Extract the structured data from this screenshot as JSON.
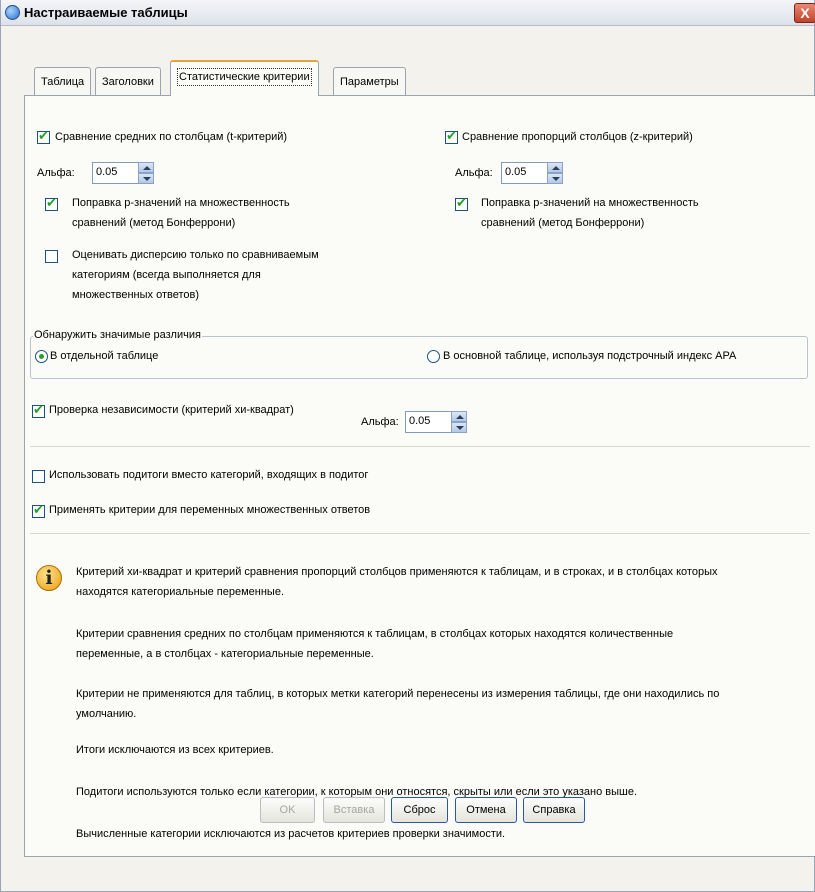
{
  "window": {
    "title": "Настраиваемые таблицы",
    "close_glyph": "X"
  },
  "tabs": [
    {
      "label": "Таблица"
    },
    {
      "label": "Заголовки"
    },
    {
      "label": "Статистические критерии",
      "active": true
    },
    {
      "label": "Параметры"
    }
  ],
  "means": {
    "label": "Сравнение средних по столбцам (t-критерий)",
    "checked": true,
    "alpha_label": "Альфа:",
    "alpha_value": "0.05",
    "bonferroni_line1": "Поправка p-значений на множественность",
    "bonferroni_line2": "сравнений (метод Бонферрони)",
    "bonferroni_checked": true,
    "variance_line1": "Оценивать дисперсию только по сравниваемым",
    "variance_line2": "категориям (всегда выполняется для",
    "variance_line3": "множественных ответов)",
    "variance_checked": false
  },
  "props": {
    "label": "Сравнение пропорций столбцов (z-критерий)",
    "checked": true,
    "alpha_label": "Альфа:",
    "alpha_value": "0.05",
    "bonferroni_line1": "Поправка p-значений на множественность",
    "bonferroni_line2": "сравнений (метод Бонферрони)",
    "bonferroni_checked": true
  },
  "identify": {
    "legend": "Обнаружить значимые различия",
    "separate_table": "В отдельной таблице",
    "main_table": "В основной таблице, используя подстрочный индекс APA",
    "selected": "separate_table"
  },
  "chisq": {
    "label": "Проверка независимости (критерий хи-квадрат)",
    "checked": true,
    "alpha_label": "Альфа:",
    "alpha_value": "0.05"
  },
  "subtotals": {
    "label": "Использовать подитоги вместо категорий, входящих в подитог",
    "checked": false
  },
  "multiresp": {
    "label": "Применять критерии для переменных множественных ответов",
    "checked": true
  },
  "notes": {
    "p1_line1": "Критерий хи-квадрат и критерий сравнения пропорций столбцов применяются к таблицам, и в строках, и в столбцах которых",
    "p1_line2": "находятся категориальные переменные.",
    "p2_line1": "Критерии сравнения средних по столбцам применяются к таблицам, в столбцах которых находятся количественные",
    "p2_line2": "переменные, а в столбцах - категориальные переменные.",
    "p3_line1": "Критерии не применяются для таблиц, в которых метки категорий перенесены из измерения таблицы, где они находились по",
    "p3_line2": "умолчанию.",
    "p4": "Итоги исключаются из всех критериев.",
    "p5": "Подитоги используются только если категории, к которым они относятся, скрыты или если это указано выше.",
    "p6": "Вычисленные категории исключаются из расчетов критериев проверки значимости."
  },
  "buttons": {
    "ok": "OK",
    "paste": "Вставка",
    "reset": "Сброс",
    "cancel": "Отмена",
    "help": "Справка"
  },
  "icons": {
    "info": "info-icon",
    "app": "app-icon"
  },
  "colors": {
    "check": "#21a121",
    "active_tab_accent": "#e6a23c",
    "close": "#c1432b"
  }
}
